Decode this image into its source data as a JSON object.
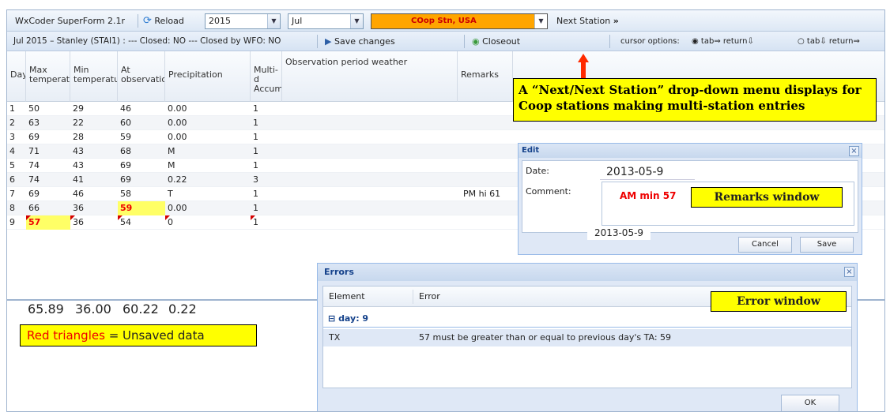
{
  "toolbar": {
    "app_title": "WxCoder SuperForm 2.1r",
    "reload_label": "Reload",
    "year": "2015",
    "month": "Jul",
    "station": "COop Stn, USA",
    "next_station_label": "Next Station",
    "next_station_chevrons": "»"
  },
  "status": {
    "info": "Jul 2015 – Stanley (STAI1) : --- Closed: NO --- Closed by WFO: NO",
    "save_label": "Save changes",
    "closeout_label": "Closeout",
    "cursor_options_label": "cursor options:",
    "opt1": "tab⇒ return⇩",
    "opt2": "tab⇩ return⇒"
  },
  "grid": {
    "headers": {
      "day": "Day",
      "max": "Max temperatur",
      "min": "Min temperatur",
      "atobs": "At observation",
      "precip": "Precipitation",
      "multi": "Multi-d Accumu",
      "weather": "Observation period weather",
      "remarks": "Remarks"
    },
    "rows": [
      {
        "day": "1",
        "max": "50",
        "min": "29",
        "at": "46",
        "precip": "0.00",
        "multi": "1",
        "remarks": ""
      },
      {
        "day": "2",
        "max": "63",
        "min": "22",
        "at": "60",
        "precip": "0.00",
        "multi": "1",
        "remarks": ""
      },
      {
        "day": "3",
        "max": "69",
        "min": "28",
        "at": "59",
        "precip": "0.00",
        "multi": "1",
        "remarks": ""
      },
      {
        "day": "4",
        "max": "71",
        "min": "43",
        "at": "68",
        "precip": "M",
        "multi": "1",
        "remarks": ""
      },
      {
        "day": "5",
        "max": "74",
        "min": "43",
        "at": "69",
        "precip": "M",
        "multi": "1",
        "remarks": ""
      },
      {
        "day": "6",
        "max": "74",
        "min": "41",
        "at": "69",
        "precip": "0.22",
        "multi": "3",
        "remarks": ""
      },
      {
        "day": "7",
        "max": "69",
        "min": "46",
        "at": "58",
        "precip": "T",
        "multi": "1",
        "remarks": "PM hi 61"
      },
      {
        "day": "8",
        "max": "66",
        "min": "36",
        "at": "59",
        "precip": "0.00",
        "multi": "1",
        "remarks": ""
      },
      {
        "day": "9",
        "max": "57",
        "min": "36",
        "at": "54",
        "precip": "0",
        "multi": "1",
        "remarks": ""
      }
    ],
    "totals": {
      "max": "65.89",
      "min": "36.00",
      "at": "60.22",
      "precip": "0.22"
    }
  },
  "callouts": {
    "next_station": "A “Next/Next Station” drop-down menu displays for Coop stations making multi-station entries",
    "unsaved_red": "Red triangles",
    "unsaved_rest": " = Unsaved data",
    "remarks": "Remarks window",
    "error": "Error window"
  },
  "edit_window": {
    "title": "Edit",
    "date_label": "Date:",
    "date_value": "2013-05-9",
    "comment_label": "Comment:",
    "comment_value": "AM min 57",
    "date_tip": "2013-05-9",
    "cancel_label": "Cancel",
    "save_label": "Save"
  },
  "errors_window": {
    "title": "Errors",
    "col_element": "Element",
    "col_error": "Error",
    "group": "day: 9",
    "row_element": "TX",
    "row_error": "57 must be greater than or equal to previous day's TA: 59",
    "ok_label": "OK"
  },
  "colors": {
    "highlight": "#ffff00",
    "unsaved_triangle": "#d40000",
    "error_text": "#ee0000",
    "station_combo": "#ffa500"
  }
}
